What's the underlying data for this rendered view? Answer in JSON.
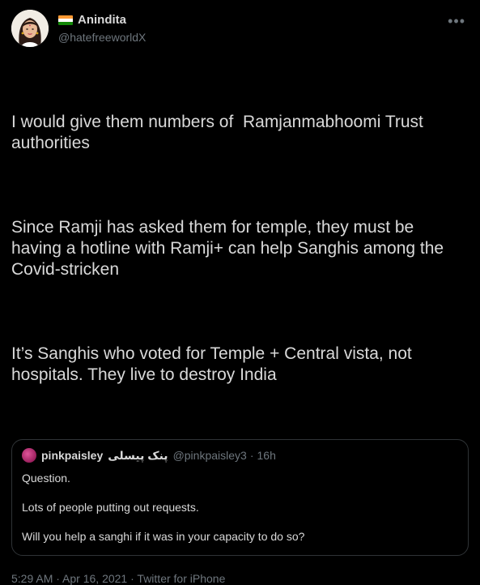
{
  "author": {
    "display_name": "Anindita",
    "handle": "@hatefreeworldX",
    "flag_colors": [
      "#ff9933",
      "#ffffff",
      "#138808"
    ]
  },
  "menu": {
    "more_glyph": "•••"
  },
  "tweet": {
    "paragraphs": [
      "I would give them numbers of  Ramjanmabhoomi Trust authorities",
      "Since Ramji has asked them for temple, they must be having a hotline with Ramji+ can help Sanghis among the Covid-stricken",
      "It’s Sanghis who voted for Temple + Central vista, not hospitals. They live to destroy India"
    ]
  },
  "quote": {
    "display_name": "pinkpaisley",
    "display_name_urdu": "پنک پیسلی",
    "handle": "@pinkpaisley3",
    "separator": "·",
    "time": "16h",
    "paragraphs": [
      "Question.",
      "Lots of people putting out requests.",
      "Will you help a sanghi if it was in your capacity to do so?"
    ]
  },
  "meta": {
    "time": "5:29 AM",
    "separator": " · ",
    "date": "Apr 16, 2021",
    "source": "Twitter for iPhone"
  },
  "colors": {
    "background": "#000000",
    "text": "#d9d9d9",
    "secondary": "#6e767d",
    "border": "#2f3336"
  }
}
